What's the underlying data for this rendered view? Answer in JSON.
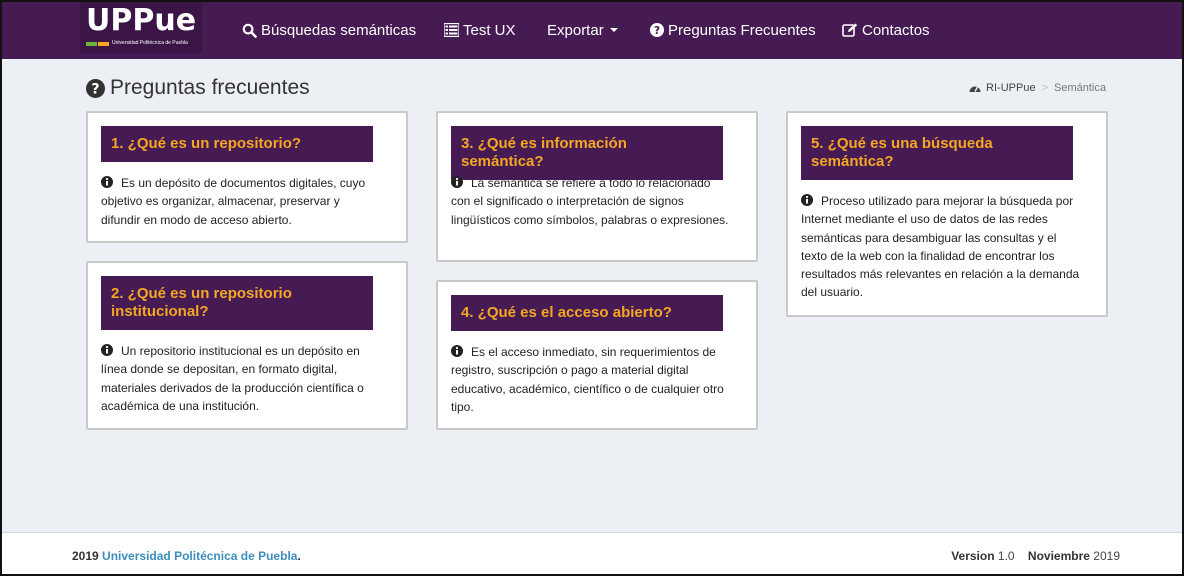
{
  "brand": {
    "logo_text": "UPPue",
    "subtitle": "Universidad Politécnica de Puebla"
  },
  "nav": {
    "items": [
      {
        "label": "Búsquedas semánticas",
        "icon": "search-icon"
      },
      {
        "label": "Test UX",
        "icon": "list-icon"
      },
      {
        "label": "Exportar",
        "icon": "caret-down-icon"
      },
      {
        "label": "Preguntas Frecuentes",
        "icon": "question-circle-icon"
      },
      {
        "label": "Contactos",
        "icon": "edit-icon"
      }
    ]
  },
  "page": {
    "title": "Preguntas frecuentes"
  },
  "breadcrumb": {
    "home": "RI-UPPue",
    "current": "Semántica"
  },
  "faqs": [
    {
      "title": "1. ¿Qué es un repositorio?",
      "body": "Es un depósito de documentos digitales, cuyo objetivo es organizar, almacenar, preservar y difundir en modo de acceso abierto."
    },
    {
      "title": "2. ¿Qué es un repositorio institucional?",
      "body": "Un repositorio institucional es un depósito en línea donde se depositan, en formato digital, materiales derivados de la producción científica o académica de una institución."
    },
    {
      "title": "3. ¿Qué es información semántica?",
      "body": "La semántica se refiere a todo lo relacionado con el significado o interpretación de signos lingüísticos como símbolos, palabras o expresiones."
    },
    {
      "title": "4. ¿Qué es el acceso abierto?",
      "body": "Es el acceso inmediato, sin requerimientos de registro, suscripción o pago a material digital educativo, académico, científico o de cualquier otro tipo."
    },
    {
      "title": "5. ¿Qué es una búsqueda semántica?",
      "body": "Proceso utilizado para mejorar la búsqueda por Internet mediante el uso de datos de las redes semánticas para desambiguar las consultas y el texto de la web con la finalidad de encontrar los resultados más relevantes en relación a la demanda del usuario."
    }
  ],
  "footer": {
    "year": "2019",
    "org": "Universidad Politécnica de Puebla",
    "dot": ".",
    "version_label": "Version",
    "version": "1.0",
    "month": "Noviembre",
    "release_year": "2019"
  },
  "colors": {
    "navbar": "#461b54",
    "accent": "#f5a623",
    "link": "#3c8dbc",
    "background": "#ecf0f5"
  }
}
